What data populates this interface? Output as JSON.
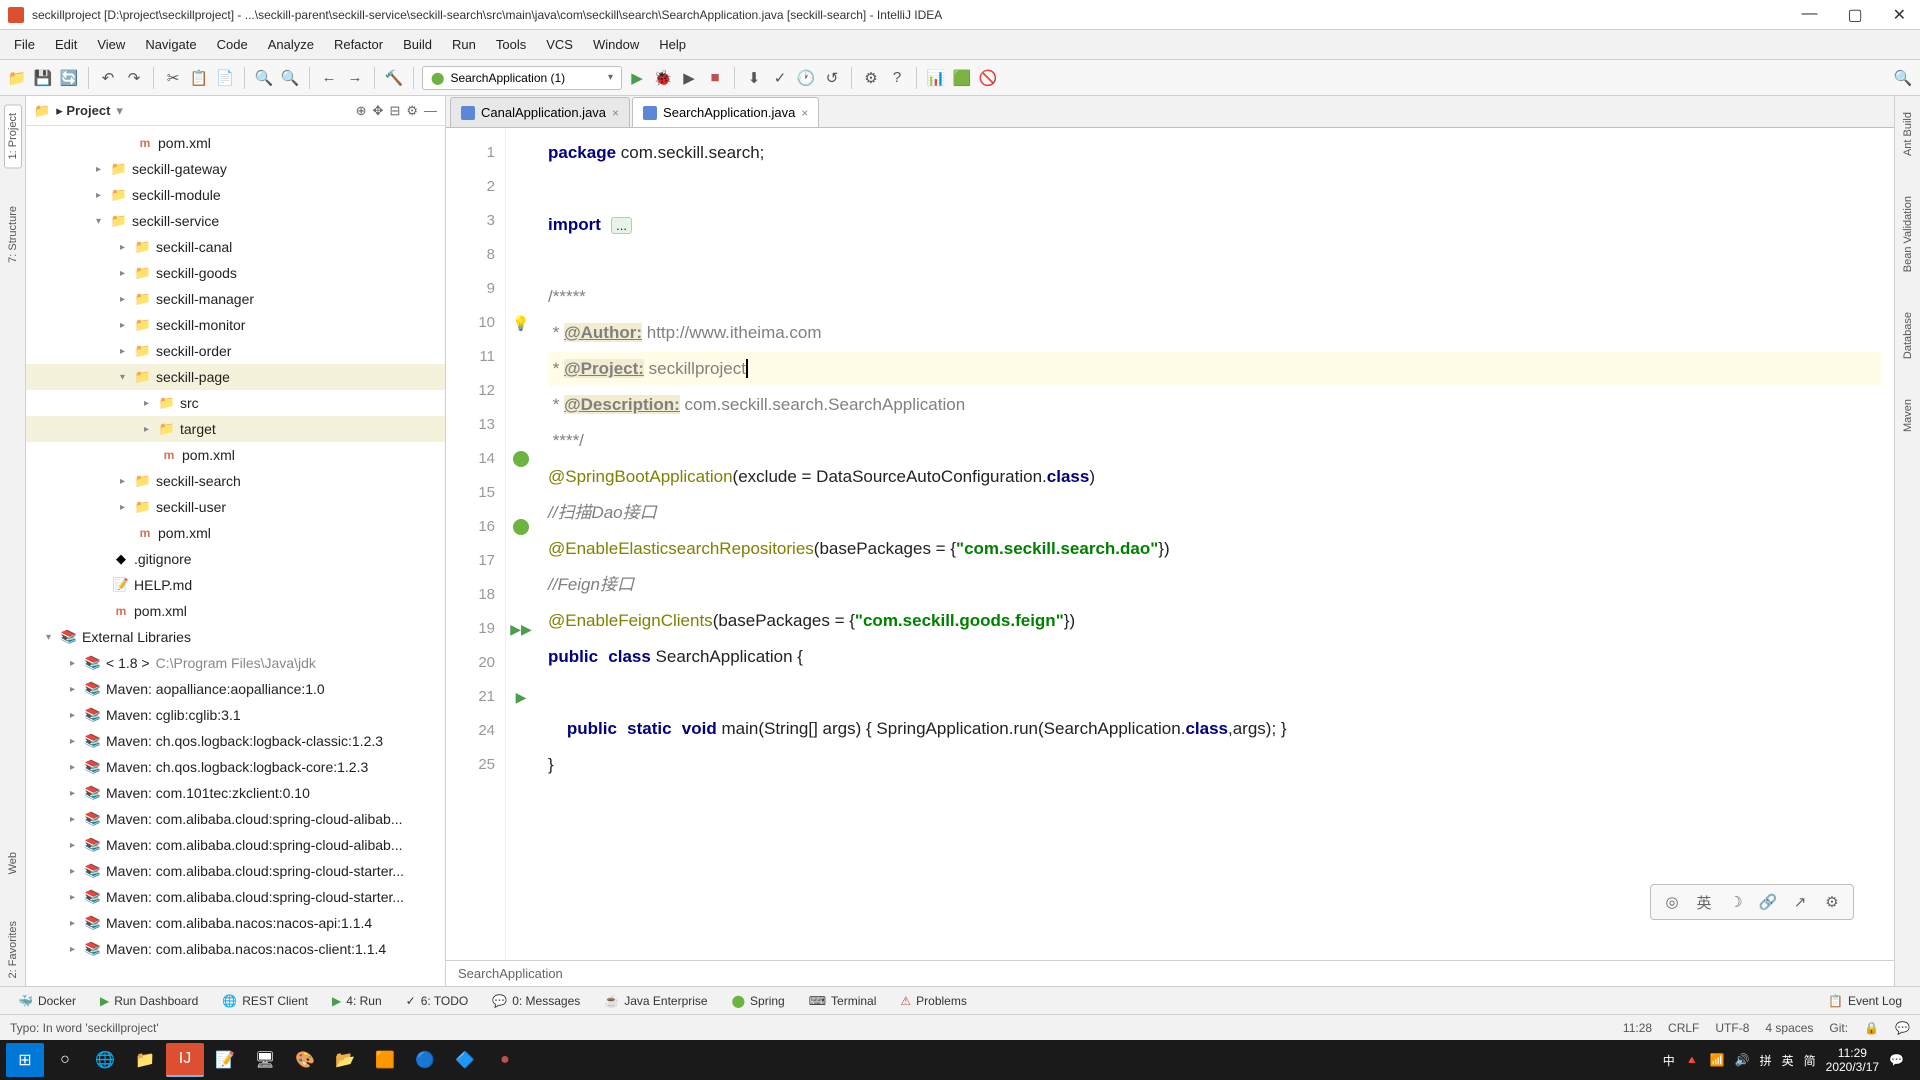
{
  "window": {
    "title": "seckillproject [D:\\project\\seckillproject] - ...\\seckill-parent\\seckill-service\\seckill-search\\src\\main\\java\\com\\seckill\\search\\SearchApplication.java [seckill-search] - IntelliJ IDEA"
  },
  "menu": {
    "file": "File",
    "edit": "Edit",
    "view": "View",
    "navigate": "Navigate",
    "code": "Code",
    "analyze": "Analyze",
    "refactor": "Refactor",
    "build": "Build",
    "run": "Run",
    "tools": "Tools",
    "vcs": "VCS",
    "window": "Window",
    "help": "Help"
  },
  "run_config": "SearchApplication (1)",
  "left_tabs": {
    "project": "1: Project",
    "structure": "7: Structure",
    "favorites": "2: Favorites",
    "web": "Web"
  },
  "right_tabs": {
    "ant": "Ant Build",
    "bean": "Bean Validation",
    "database": "Database",
    "maven": "Maven"
  },
  "project": {
    "title": "Project"
  },
  "tree": {
    "pom1": "pom.xml",
    "gateway": "seckill-gateway",
    "module": "seckill-module",
    "service": "seckill-service",
    "canal": "seckill-canal",
    "goods": "seckill-goods",
    "manager": "seckill-manager",
    "monitor": "seckill-monitor",
    "order": "seckill-order",
    "page": "seckill-page",
    "src": "src",
    "target": "target",
    "pom2": "pom.xml",
    "search": "seckill-search",
    "user": "seckill-user",
    "pom3": "pom.xml",
    "gitignore": ".gitignore",
    "help": "HELP.md",
    "pom4": "pom.xml",
    "ext_lib": "External Libraries",
    "jdk": "< 1.8 >",
    "jdk_path": "C:\\Program Files\\Java\\jdk",
    "m1": "Maven: aopalliance:aopalliance:1.0",
    "m2": "Maven: cglib:cglib:3.1",
    "m3": "Maven: ch.qos.logback:logback-classic:1.2.3",
    "m4": "Maven: ch.qos.logback:logback-core:1.2.3",
    "m5": "Maven: com.101tec:zkclient:0.10",
    "m6": "Maven: com.alibaba.cloud:spring-cloud-alibab...",
    "m7": "Maven: com.alibaba.cloud:spring-cloud-alibab...",
    "m8": "Maven: com.alibaba.cloud:spring-cloud-starter...",
    "m9": "Maven: com.alibaba.cloud:spring-cloud-starter...",
    "m10": "Maven: com.alibaba.nacos:nacos-api:1.1.4",
    "m11": "Maven: com.alibaba.nacos:nacos-client:1.1.4"
  },
  "tabs": {
    "canal": "CanalApplication.java",
    "search": "SearchApplication.java"
  },
  "line_nums": [
    "1",
    "2",
    "3",
    "8",
    "9",
    "10",
    "11",
    "12",
    "13",
    "14",
    "15",
    "16",
    "17",
    "18",
    "19",
    "20",
    "21",
    "24",
    "25"
  ],
  "code": {
    "package_kw": "package",
    "package_val": " com.seckill.search;",
    "import_kw": "import",
    "import_fold": "...",
    "doc_start": "/*****",
    "author_tag": "@Author:",
    "author_val": " http://www.itheima.com",
    "project_tag": "@Project:",
    "project_val": " seckillproject",
    "desc_tag": "@Description:",
    "desc_val": " com.seckill.search.SearchApplication",
    "doc_end": " ****/",
    "anno_sba": "@SpringBootApplication",
    "sba_args1": "(exclude = DataSourceAutoConfiguration.",
    "sba_class": "class",
    "sba_args2": ")",
    "comm_dao": "//扫描Dao接口",
    "anno_ees": "@EnableElasticsearchRepositories",
    "ees_args1": "(basePackages = {",
    "ees_str": "\"com.seckill.search.dao\"",
    "ees_args2": "})",
    "comm_feign": "//Feign接口",
    "anno_efc": "@EnableFeignClients",
    "efc_args1": "(basePackages = {",
    "efc_str": "\"com.seckill.goods.feign\"",
    "efc_args2": "})",
    "pub": "public",
    "cls": "class",
    "cls_name": " SearchApplication {",
    "main_pub": "public",
    "main_static": "static",
    "main_void": "void",
    "main_sig": " main(String[] args) { SpringApplication.run(SearchApplication.",
    "main_class": "class",
    "main_end": ",args); }",
    "close": "}"
  },
  "breadcrumb": "SearchApplication",
  "bottom_tabs": {
    "docker": "Docker",
    "run_dash": "Run Dashboard",
    "rest": "REST Client",
    "run": "4: Run",
    "todo": "6: TODO",
    "messages": "0: Messages",
    "java_ee": "Java Enterprise",
    "spring": "Spring",
    "terminal": "Terminal",
    "problems": "Problems",
    "event_log": "Event Log"
  },
  "status": {
    "typo": "Typo: In word 'seckillproject'",
    "pos": "11:28",
    "crlf": "CRLF",
    "enc": "UTF-8",
    "spaces": "4 spaces",
    "git": "Git:"
  },
  "taskbar": {
    "time": "11:29",
    "date": "2020/3/17",
    "ime1": "中",
    "ime2": "拼",
    "ime3": "英",
    "ime4": "简"
  }
}
